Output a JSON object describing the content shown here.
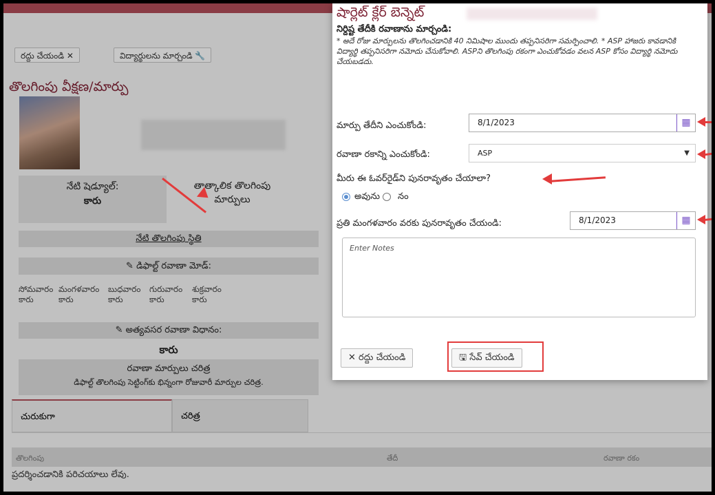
{
  "toolbar": {
    "cancel_label": "రద్దు చేయండి ✕",
    "change_students_label": "విద్యార్థులను మార్చండి 🔧"
  },
  "page": {
    "title": "తొలగింపు వీక్షణ/మార్పు"
  },
  "schedule": {
    "label": "నేటి షెడ్యూల్:",
    "value": "కారు",
    "temp_changes_label": "తాత్కాలిక తొలగింపు మార్పులు",
    "today_status_link": "నేటి తొలగింపు స్థితి",
    "default_mode_label": "డిఫాల్ట్ రవాణా మోడ్:",
    "days": [
      {
        "day": "సోమవారం",
        "mode": "కారు"
      },
      {
        "day": "మంగళవారం",
        "mode": "కారు"
      },
      {
        "day": "బుధవారం",
        "mode": "కారు"
      },
      {
        "day": "గురువారం",
        "mode": "కారు"
      },
      {
        "day": "శుక్రవారం",
        "mode": "కారు"
      }
    ],
    "emergency_label": "అత్యవసర రవాణా విధానం:",
    "emergency_value": "కారు",
    "history_title": "రవాణా మార్పులు చరిత్ర",
    "history_desc": "డిఫాల్ట్ తొలగింపు సెట్టింగ్‌కు భిన్నంగా రోజువారీ మార్పుల చరిత్ర."
  },
  "tabs": [
    {
      "label": "చురుకుగా"
    },
    {
      "label": "చరిత్ర"
    }
  ],
  "table": {
    "columns": [
      "తొలగింపు",
      "తేదీ",
      "రవాణా రకం"
    ],
    "empty_message": "ప్రదర్శించడానికి పరిచయాలు లేవు."
  },
  "modal": {
    "title": "షార్లెట్ క్లేర్ బెన్నెట్",
    "instr_head": "నిర్దిష్ట తేదీకి రవాణాను మార్చండి:",
    "instr_body": "* అదే రోజు మార్పులను తొలగించడానికి 40 నిమిషాల ముందు తప్పనిసరిగా సమర్పించాలి. * ASP హాజరు కావడానికి విద్యార్థి తప్పనిసరిగా నమోదు చేసుకోవాలి. ASPని తొలగింపు రకంగా ఎంచుకోవడం వలన ASP కోసం విద్యార్థి నమోదు చేయబడదు.",
    "change_date_label": "మార్పు తేదీని ఎంచుకోండి:",
    "change_date_value": "8/1/2023",
    "transport_type_label": "రవాణా రకాన్ని ఎంచుకోండి:",
    "transport_type_value": "ASP",
    "repeat_question": "మీరు ఈ ఓవర్‌రైడ్‌ని పునరావృతం చేయాలా?",
    "repeat_yes": "అవును",
    "repeat_no": "నం",
    "repeat_until_label": "ప్రతి మంగళవారం వరకు పునరావృతం చేయండి:",
    "repeat_until_value": "8/1/2023",
    "notes_placeholder": "Enter Notes",
    "cancel_button": "రద్దు చేయండి",
    "save_button": "సేవ్ చేయండి"
  },
  "colors": {
    "accent": "#7a1f31",
    "annotation": "#e23b3b",
    "calendar_icon": "#7a55c8"
  }
}
